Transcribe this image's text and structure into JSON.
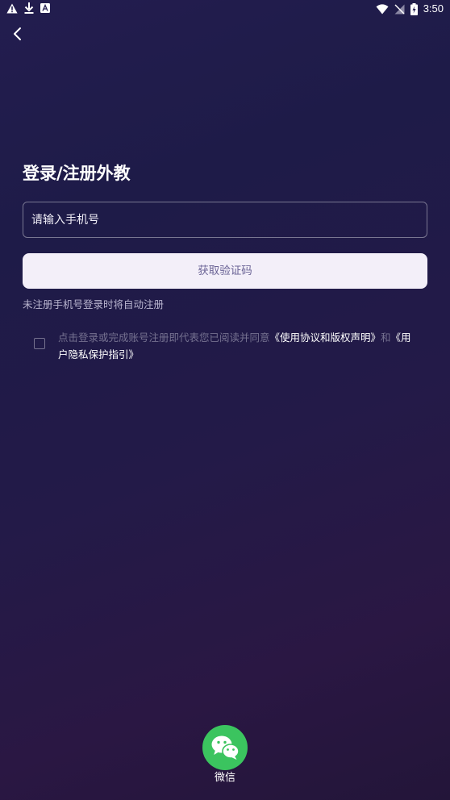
{
  "status_bar": {
    "time": "3:50",
    "left_icons": [
      "alert-icon",
      "download-icon",
      "app-notification-icon"
    ],
    "right_icons": [
      "wifi-icon",
      "no-signal-icon",
      "battery-charging-icon"
    ]
  },
  "nav": {
    "back_icon": "back-arrow-icon"
  },
  "title": "登录/注册外教",
  "phone": {
    "placeholder": "请输入手机号",
    "value": ""
  },
  "code_button": {
    "label": "获取验证码"
  },
  "hint": "未注册手机号登录时将自动注册",
  "agreement": {
    "checked": false,
    "prefix": "点击登录或完成账号注册即代表您已阅读并同意",
    "link1": "《使用协议和版权声明》",
    "and": "和",
    "link2": "《用户隐私保护指引》"
  },
  "wechat": {
    "icon": "wechat-icon",
    "label": "微信"
  },
  "colors": {
    "background_top": "#1e1b48",
    "background_bottom": "#2a1743",
    "button_bg": "#f3eff9",
    "button_text": "#6b6496",
    "wechat_green": "#3bc45f"
  }
}
